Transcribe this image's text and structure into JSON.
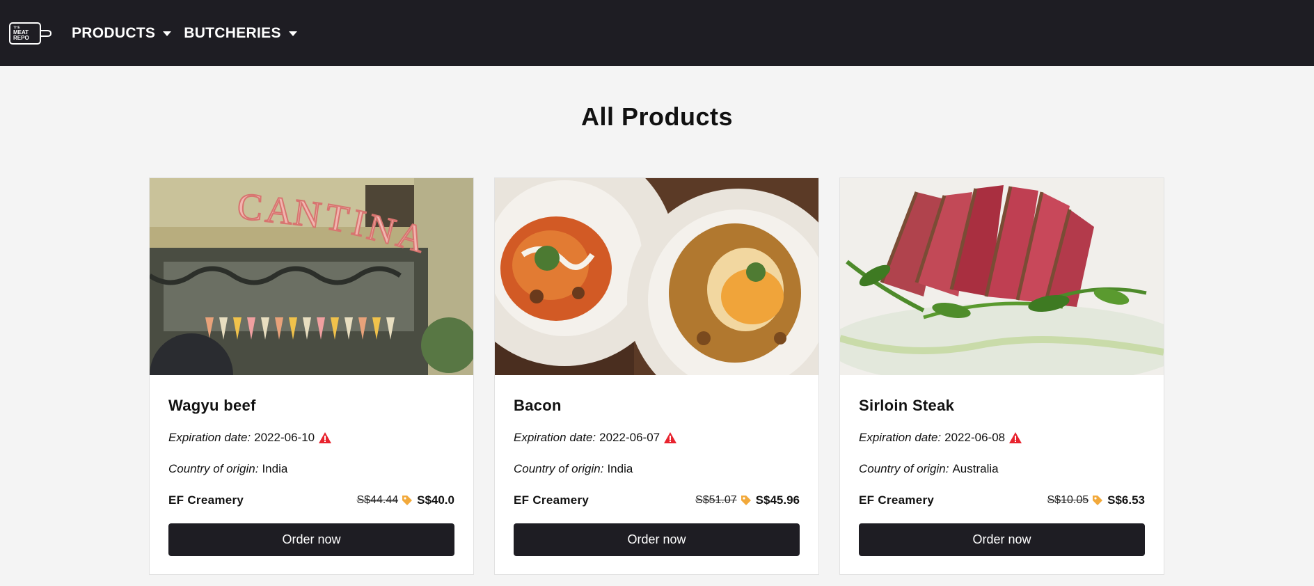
{
  "nav": {
    "logo_text": [
      "THE",
      "MEAT",
      "REPO"
    ],
    "items": [
      {
        "label": "PRODUCTS"
      },
      {
        "label": "BUTCHERIES"
      }
    ]
  },
  "page_title": "All Products",
  "products": [
    {
      "name": "Wagyu beef",
      "expiration_label": "Expiration date:",
      "expiration_date": "2022-06-10",
      "origin_label": "Country of origin:",
      "origin": "India",
      "seller": "EF Creamery",
      "old_price": "S$44.44",
      "new_price": "S$40.0",
      "button": "Order now",
      "image": "storefront-cantina-photo"
    },
    {
      "name": "Bacon",
      "expiration_label": "Expiration date:",
      "expiration_date": "2022-06-07",
      "origin_label": "Country of origin:",
      "origin": "India",
      "seller": "EF Creamery",
      "old_price": "S$51.07",
      "new_price": "S$45.96",
      "button": "Order now",
      "image": "two-plates-food-photo"
    },
    {
      "name": "Sirloin Steak",
      "expiration_label": "Expiration date:",
      "expiration_date": "2022-06-08",
      "origin_label": "Country of origin:",
      "origin": "Australia",
      "seller": "EF Creamery",
      "old_price": "S$10.05",
      "new_price": "S$6.53",
      "button": "Order now",
      "image": "seared-steak-photo"
    }
  ],
  "colors": {
    "navbar": "#1e1d23",
    "background": "#f4f4f4",
    "warning": "#e8232e",
    "tag": "#f2a93b"
  }
}
